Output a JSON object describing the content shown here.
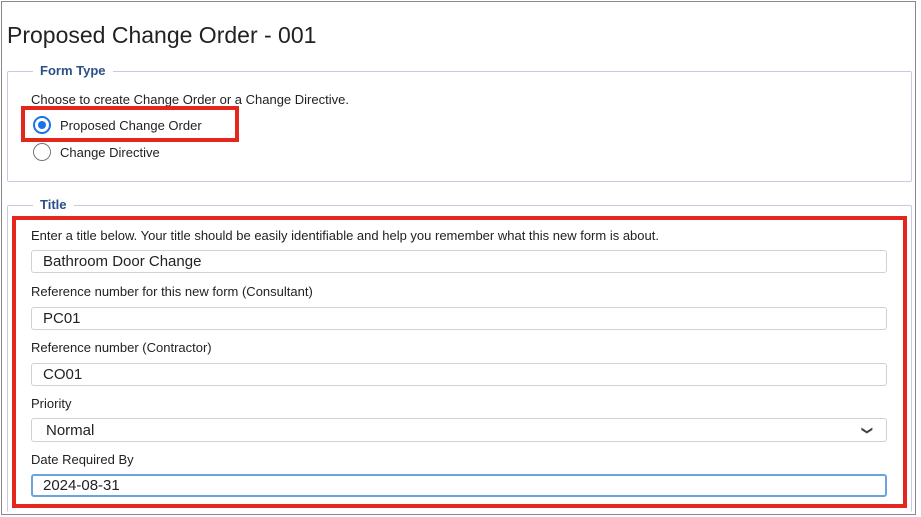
{
  "page": {
    "title": "Proposed Change Order - 001"
  },
  "form_type": {
    "legend": "Form Type",
    "instruction": "Choose to create Change Order or a Change Directive.",
    "options": [
      {
        "label": "Proposed Change Order",
        "checked": true
      },
      {
        "label": "Change Directive",
        "checked": false
      }
    ]
  },
  "title_section": {
    "legend": "Title",
    "instruction": "Enter a title below. Your title should be easily identifiable and help you remember what this new form is about.",
    "title_value": "Bathroom Door Change",
    "ref_consultant_label": "Reference number for this new form (Consultant)",
    "ref_consultant_value": "PC01",
    "ref_contractor_label": "Reference number (Contractor)",
    "ref_contractor_value": "CO01",
    "priority_label": "Priority",
    "priority_value": "Normal",
    "date_label": "Date Required By",
    "date_value": "2024-08-31"
  },
  "colors": {
    "highlight": "#e3271c",
    "legend": "#2b4f87",
    "radio_selected": "#1a73e8",
    "focus_border": "#6ba2e0"
  },
  "icons": {
    "select_arrow": "chevron-down-icon"
  }
}
